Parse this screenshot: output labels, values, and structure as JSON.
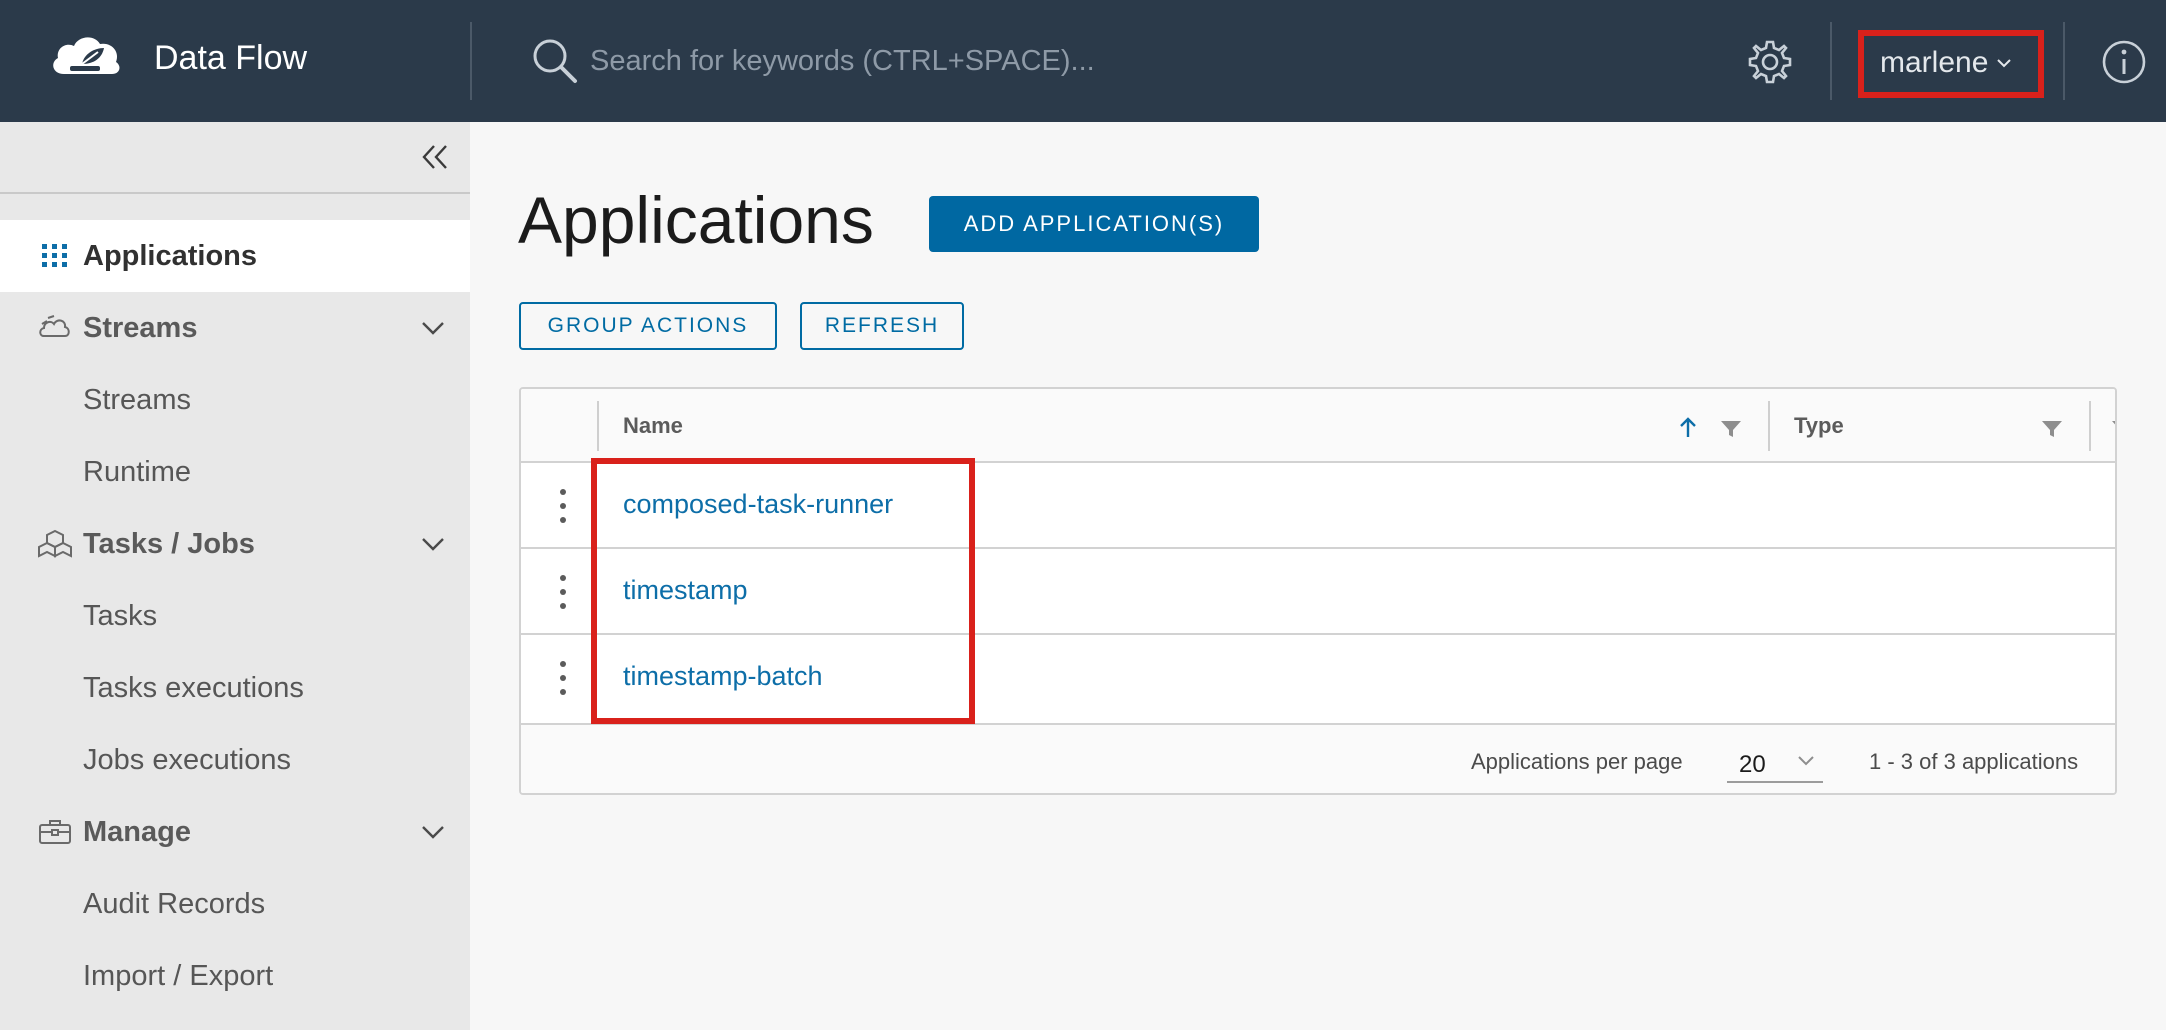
{
  "app": {
    "title": "Data Flow"
  },
  "search": {
    "placeholder": "Search for keywords (CTRL+SPACE)..."
  },
  "header": {
    "user": "marlene"
  },
  "sidebar": {
    "items": [
      {
        "label": "Applications",
        "active": true
      },
      {
        "label": "Streams",
        "group": true
      },
      {
        "label": "Streams"
      },
      {
        "label": "Runtime"
      },
      {
        "label": "Tasks / Jobs",
        "group": true
      },
      {
        "label": "Tasks"
      },
      {
        "label": "Tasks executions"
      },
      {
        "label": "Jobs executions"
      },
      {
        "label": "Manage",
        "group": true
      },
      {
        "label": "Audit Records"
      },
      {
        "label": "Import / Export"
      }
    ]
  },
  "main": {
    "title": "Applications",
    "add_button": "ADD APPLICATION(S)",
    "group_actions_button": "GROUP ACTIONS",
    "refresh_button": "REFRESH"
  },
  "grid": {
    "columns": [
      "Name",
      "Type"
    ],
    "rows": [
      {
        "name": "composed-task-runner"
      },
      {
        "name": "timestamp"
      },
      {
        "name": "timestamp-batch"
      }
    ],
    "footer": {
      "per_page_label": "Applications per page",
      "per_page_value": "20",
      "count": "1 - 3 of 3 applications"
    }
  },
  "colors": {
    "header_bg": "#2b3a4a",
    "primary": "#0068a2",
    "link": "#0d6ea8",
    "highlight": "#d9211b"
  }
}
